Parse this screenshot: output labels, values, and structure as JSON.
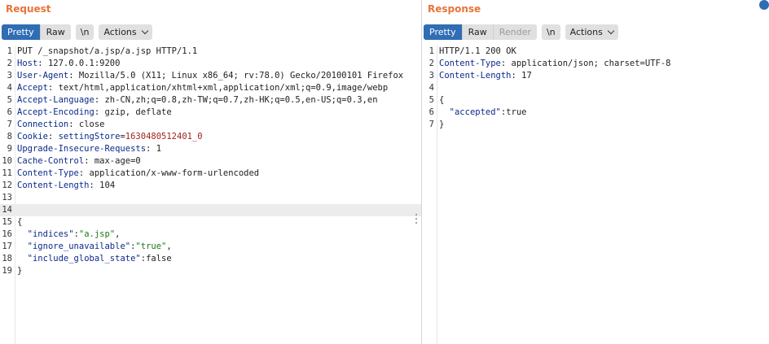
{
  "request": {
    "title": "Request",
    "tabs": [
      "Pretty",
      "Raw"
    ],
    "newline_label": "\\n",
    "actions_label": "Actions",
    "lines": [
      {
        "n": "1",
        "text": "PUT /_snapshot/a.jsp/a.jsp HTTP/1.1"
      },
      {
        "n": "2",
        "name": "Host",
        "value": "127.0.0.1:9200"
      },
      {
        "n": "3",
        "name": "User-Agent",
        "value": "Mozilla/5.0 (X11; Linux x86_64; rv:78.0) Gecko/20100101 Firefox"
      },
      {
        "n": "4",
        "name": "Accept",
        "value": "text/html,application/xhtml+xml,application/xml;q=0.9,image/webp"
      },
      {
        "n": "5",
        "name": "Accept-Language",
        "value": "zh-CN,zh;q=0.8,zh-TW;q=0.7,zh-HK;q=0.5,en-US;q=0.3,en"
      },
      {
        "n": "6",
        "name": "Accept-Encoding",
        "value": "gzip, deflate"
      },
      {
        "n": "7",
        "name": "Connection",
        "value": "close"
      },
      {
        "n": "8",
        "name": "Cookie",
        "cookie_name": "settingStore",
        "cookie_value": "1630480512401_0"
      },
      {
        "n": "9",
        "name": "Upgrade-Insecure-Requests",
        "value": "1"
      },
      {
        "n": "10",
        "name": "Cache-Control",
        "value": "max-age=0"
      },
      {
        "n": "11",
        "name": "Content-Type",
        "value": "application/x-www-form-urlencoded"
      },
      {
        "n": "12",
        "name": "Content-Length",
        "value": "104"
      },
      {
        "n": "13",
        "text": ""
      },
      {
        "n": "14",
        "text": ""
      },
      {
        "n": "15",
        "text": "{"
      },
      {
        "n": "16",
        "key": "\"indices\"",
        "sep": ":",
        "str": "\"a.jsp\"",
        "tail": ","
      },
      {
        "n": "17",
        "key": "\"ignore_unavailable\"",
        "sep": ":",
        "str": "\"true\"",
        "tail": ","
      },
      {
        "n": "18",
        "key": "\"include_global_state\"",
        "sep": ":",
        "plain": "false"
      },
      {
        "n": "19",
        "text": "}"
      }
    ]
  },
  "response": {
    "title": "Response",
    "tabs": [
      "Pretty",
      "Raw",
      "Render"
    ],
    "newline_label": "\\n",
    "actions_label": "Actions",
    "lines": [
      {
        "n": "1",
        "text": "HTTP/1.1 200 OK"
      },
      {
        "n": "2",
        "name": "Content-Type",
        "value": "application/json; charset=UTF-8"
      },
      {
        "n": "3",
        "name": "Content-Length",
        "value": "17"
      },
      {
        "n": "4",
        "text": ""
      },
      {
        "n": "5",
        "text": "{"
      },
      {
        "n": "6",
        "key": "\"accepted\"",
        "sep": ":",
        "plain": "true"
      },
      {
        "n": "7",
        "text": "}"
      }
    ]
  },
  "colors": {
    "title": "#e8743b",
    "active_tab": "#2f6db5",
    "header_name": "#0b2a8a",
    "cookie_value": "#a0241c",
    "json_string": "#1a7a1a"
  }
}
